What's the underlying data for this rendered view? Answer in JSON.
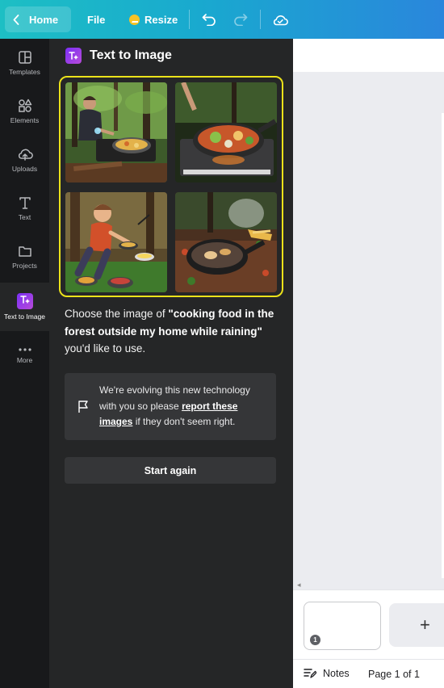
{
  "topbar": {
    "home_label": "Home",
    "file_label": "File",
    "resize_label": "Resize"
  },
  "rail": {
    "items": [
      {
        "label": "Templates",
        "icon": "templates-icon"
      },
      {
        "label": "Elements",
        "icon": "elements-icon"
      },
      {
        "label": "Uploads",
        "icon": "uploads-icon"
      },
      {
        "label": "Text",
        "icon": "text-icon"
      },
      {
        "label": "Projects",
        "icon": "projects-icon"
      },
      {
        "label": "Text to Image",
        "icon": "text-to-image-icon"
      },
      {
        "label": "More",
        "icon": "more-icon"
      }
    ],
    "active": "Text to Image"
  },
  "panel": {
    "title": "Text to Image",
    "caption_pre": "Choose the image of ",
    "caption_prompt": "\"cooking food in the forest outside my home while raining\"",
    "caption_post": " you'd like to use.",
    "notice_pre": "We're evolving this new technology with you so please ",
    "notice_link": "report these images",
    "notice_post": " if they don't seem right.",
    "start_again": "Start again",
    "selection_color": "#ebe21a"
  },
  "pages": {
    "page_number": "1",
    "add_label": "+",
    "notes_label": "Notes",
    "page_count": "Page 1 of 1"
  },
  "colors": {
    "topbar_start": "#1dbfc4",
    "topbar_end": "#2a86dc",
    "panel_bg": "#252627",
    "rail_bg": "#18191b"
  }
}
